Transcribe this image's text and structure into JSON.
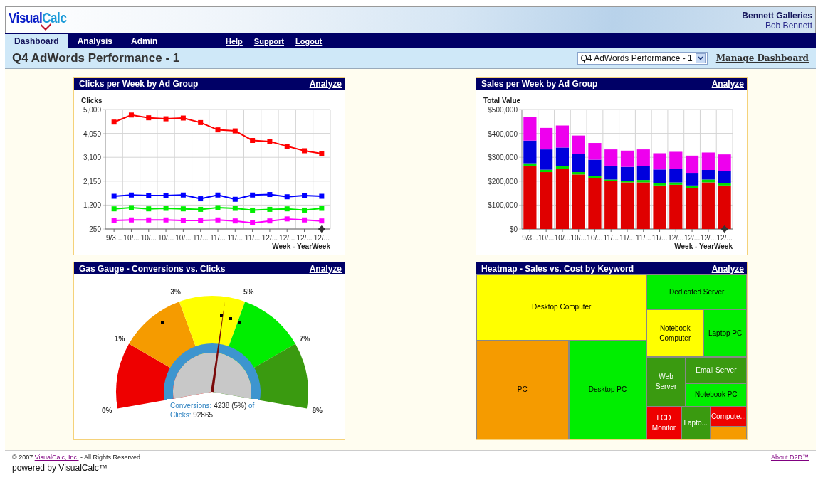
{
  "logo": {
    "left": "Visual",
    "right": "Calc"
  },
  "account": {
    "company": "Bennett Galleries",
    "user": "Bob Bennett"
  },
  "nav_tabs": [
    {
      "label": "Dashboard",
      "selected": true
    },
    {
      "label": "Analysis",
      "selected": false
    },
    {
      "label": "Admin",
      "selected": false
    }
  ],
  "nav_links": [
    "Help",
    "Support",
    "Logout"
  ],
  "page_title": "Q4 AdWords Performance - 1",
  "dashboard_select": {
    "value": "Q4 AdWords Performance - 1"
  },
  "manage_link": "Manage Dashboard",
  "panels": [
    {
      "kind": "line",
      "title": "Clicks per Week by Ad Group",
      "action": "Analyze",
      "chart_data": {
        "type": "line",
        "grid": true,
        "ylabel": "Clicks",
        "xlabel": "Week - YearWeek",
        "categories": [
          "9/3...",
          "10/...",
          "10/...",
          "10/...",
          "10/...",
          "11/...",
          "11/...",
          "11/...",
          "11/...",
          "12/...",
          "12/...",
          "12/...",
          "12/..."
        ],
        "ylim": [
          250,
          5000
        ],
        "yticks": [
          {
            "value": 250,
            "label": "250"
          },
          {
            "value": 1200,
            "label": "1,200"
          },
          {
            "value": 2150,
            "label": "2,150"
          },
          {
            "value": 3100,
            "label": "3,100"
          },
          {
            "value": 4050,
            "label": "4,050"
          },
          {
            "value": 5000,
            "label": "5,000"
          }
        ],
        "series": [
          {
            "color": "#ff0000",
            "marker": "square",
            "values": [
              4500,
              4780,
              4670,
              4630,
              4660,
              4480,
              4190,
              4150,
              3770,
              3730,
              3540,
              3360,
              3250
            ]
          },
          {
            "color": "#0000ff",
            "marker": "square",
            "values": [
              1550,
              1600,
              1580,
              1580,
              1600,
              1450,
              1600,
              1430,
              1600,
              1620,
              1530,
              1580,
              1550
            ]
          },
          {
            "color": "#00ee00",
            "marker": "square",
            "values": [
              1050,
              1100,
              1050,
              1070,
              1050,
              1030,
              1100,
              1070,
              1000,
              1030,
              1050,
              1000,
              1070
            ]
          },
          {
            "color": "#ff00ff",
            "marker": "square",
            "values": [
              590,
              610,
              610,
              610,
              590,
              590,
              610,
              570,
              490,
              570,
              650,
              610,
              570
            ]
          }
        ]
      }
    },
    {
      "kind": "bar",
      "title": "Sales per Week by Ad Group",
      "action": "Analyze",
      "chart_data": {
        "type": "bar",
        "stacked": true,
        "grid": true,
        "ylabel": "Total Value",
        "xlabel": "Week - YearWeek",
        "categories": [
          "9/3...",
          "10/...",
          "10/...",
          "10/...",
          "10/...",
          "11/...",
          "11/...",
          "11/...",
          "11/...",
          "12/...",
          "12/...",
          "12/...",
          "12/..."
        ],
        "ylim": [
          0,
          500000
        ],
        "yticks": [
          {
            "value": 0,
            "label": "$0"
          },
          {
            "value": 100000,
            "label": "$100,000"
          },
          {
            "value": 200000,
            "label": "$200,000"
          },
          {
            "value": 300000,
            "label": "$300,000"
          },
          {
            "value": 400000,
            "label": "$400,000"
          },
          {
            "value": 500000,
            "label": "$500,000"
          }
        ],
        "series": [
          {
            "color": "#e00000",
            "values": [
              265000,
              238000,
              252000,
              228000,
              212000,
              200000,
              195000,
              195000,
              182000,
              185000,
              172000,
              195000,
              182000
            ]
          },
          {
            "color": "#00dd00",
            "values": [
              10000,
              10000,
              12000,
              10000,
              10000,
              7000,
              7000,
              10000,
              10000,
              10000,
              10000,
              12000,
              10000
            ]
          },
          {
            "color": "#0000dd",
            "values": [
              95000,
              85000,
              77000,
              75000,
              68000,
              58000,
              58000,
              58000,
              57000,
              55000,
              53000,
              40000,
              50000
            ]
          },
          {
            "color": "#ee00ee",
            "values": [
              100000,
              90000,
              92000,
              78000,
              70000,
              68000,
              68000,
              70000,
              68000,
              73000,
              72000,
              73000,
              70000
            ]
          }
        ]
      }
    },
    {
      "kind": "gauge",
      "title": "Gas Gauge - Conversions vs. Clicks",
      "action": "Analyze",
      "gauge": {
        "labels": [
          "0%",
          "1%",
          "3%",
          "5%",
          "7%",
          "8%"
        ],
        "segments": [
          {
            "color": "#ee0000"
          },
          {
            "color": "#f59b00"
          },
          {
            "color": "#ffff00"
          },
          {
            "color": "#00ee00"
          },
          {
            "color": "#3a9a10"
          }
        ],
        "tooltip": [
          {
            "label": "Conversions:",
            "value": "4238 (5%)",
            "suffix": "of"
          },
          {
            "label": "Clicks:",
            "value": "92865"
          }
        ]
      }
    },
    {
      "kind": "treemap",
      "title": "Heatmap - Sales vs. Cost by Keyword",
      "action": "Analyze",
      "cells": [
        {
          "label": "Desktop Computer",
          "color": "#ffff00"
        },
        {
          "label": "Dedicated Server",
          "color": "#00ee00"
        },
        {
          "label": "Notebook Computer",
          "color": "#ffff00"
        },
        {
          "label": "Laptop PC",
          "color": "#00ee00"
        },
        {
          "label": "PC",
          "color": "#f59b00"
        },
        {
          "label": "Desktop PC",
          "color": "#00ee00"
        },
        {
          "label": "Web Server",
          "color": "#3a9a10"
        },
        {
          "label": "Email Server",
          "color": "#3a9a10"
        },
        {
          "label": "Notebook PC",
          "color": "#00ee00"
        },
        {
          "label": "LCD Monitor",
          "color": "#ee0000"
        },
        {
          "label": "Lapto...",
          "color": "#3a9a10"
        },
        {
          "label": "Compute...",
          "color": "#ee0000"
        },
        {
          "color": "#f59b00"
        }
      ]
    }
  ],
  "footer": {
    "copyright_prefix": "© 2007",
    "company_link": "VisualCalc, Inc.",
    "copyright_suffix": "- All Rights Reserved",
    "about_link": "About D2D™",
    "powered_by": "powered by VisualCalc™"
  }
}
